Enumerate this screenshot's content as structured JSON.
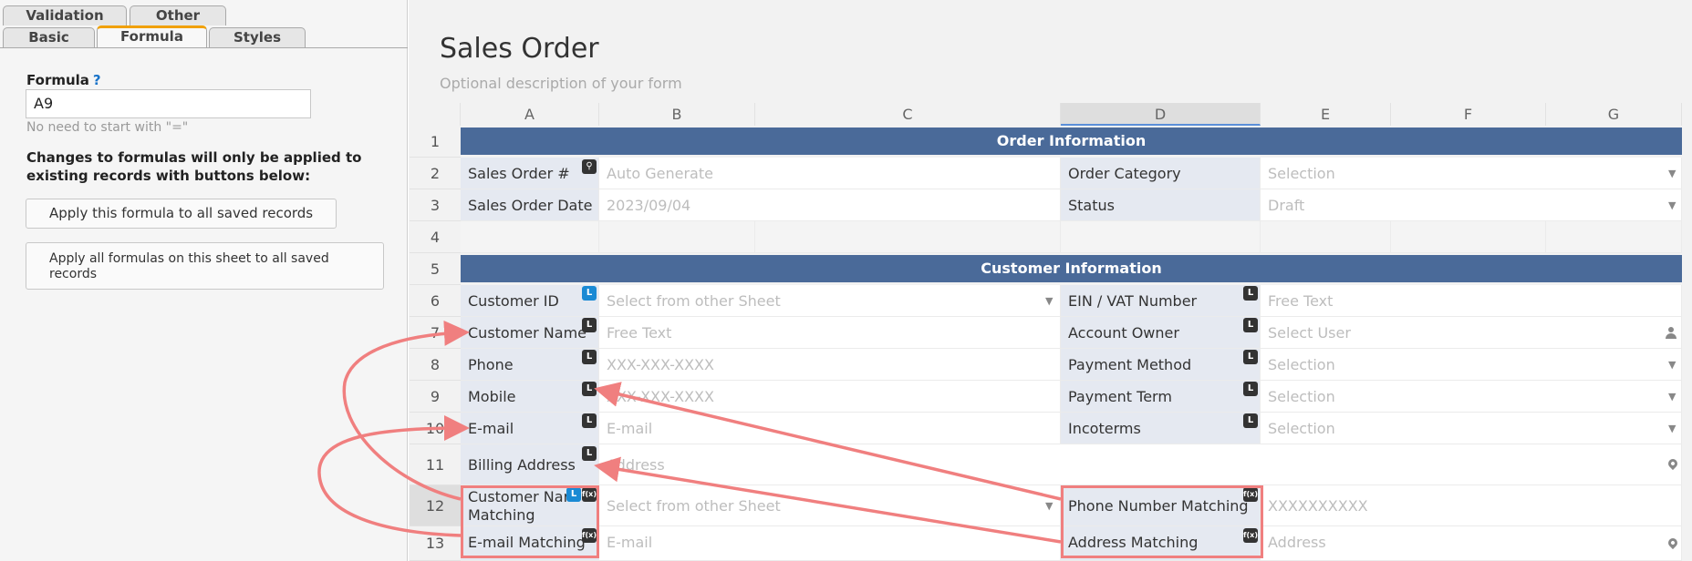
{
  "tabs": {
    "validation": "Validation",
    "other": "Other",
    "basic": "Basic",
    "formula": "Formula",
    "styles": "Styles"
  },
  "panel": {
    "formula_label": "Formula",
    "help_icon": "?",
    "formula_value": "A9",
    "hint": "No need to start with \"=\"",
    "warning": "Changes to formulas will only be applied to existing records with buttons below:",
    "apply_one": "Apply this formula to all saved records",
    "apply_all": "Apply all formulas on this sheet to all saved records"
  },
  "form": {
    "title": "Sales Order",
    "description": "Optional description of your form"
  },
  "columns": [
    "A",
    "B",
    "C",
    "D",
    "E",
    "F",
    "G"
  ],
  "rows": [
    "1",
    "2",
    "3",
    "4",
    "5",
    "6",
    "7",
    "8",
    "9",
    "10",
    "11",
    "12",
    "13"
  ],
  "sections": {
    "order": "Order Information",
    "customer": "Customer Information"
  },
  "fields": {
    "sales_order_no": "Sales Order #",
    "sales_order_no_ph": "Auto Generate",
    "order_category": "Order Category",
    "order_category_ph": "Selection",
    "sales_order_date": "Sales Order Date",
    "sales_order_date_val": "2023/09/04",
    "status": "Status",
    "status_val": "Draft",
    "customer_id": "Customer ID",
    "customer_id_ph": "Select from other Sheet",
    "ein": "EIN / VAT Number",
    "ein_ph": "Free Text",
    "customer_name": "Customer Name",
    "customer_name_ph": "Free Text",
    "account_owner": "Account Owner",
    "account_owner_ph": "Select User",
    "phone": "Phone",
    "phone_ph": "XXX-XXX-XXXX",
    "payment_method": "Payment Method",
    "payment_method_ph": "Selection",
    "mobile": "Mobile",
    "mobile_ph": "XXX-XXX-XXXX",
    "payment_term": "Payment Term",
    "payment_term_ph": "Selection",
    "email": "E-mail",
    "email_ph": "E-mail",
    "incoterms": "Incoterms",
    "incoterms_ph": "Selection",
    "billing_address": "Billing Address",
    "billing_address_ph": "Address",
    "customer_name_matching_1": "Customer Nar",
    "customer_name_matching_2": "Matching",
    "customer_name_matching_ph": "Select from other Sheet",
    "phone_number_matching": "Phone Number Matching",
    "phone_number_matching_ph": "XXXXXXXXXX",
    "email_matching": "E-mail Matching",
    "email_matching_ph": "E-mail",
    "address_matching": "Address Matching",
    "address_matching_ph": "Address"
  },
  "badges": {
    "link": "L",
    "formula": "f(x)"
  },
  "colors": {
    "section_bg": "#4a6a99",
    "label_bg": "#e5e9f1",
    "highlight": "#f07f7f",
    "tab_accent": "#f0a000"
  }
}
